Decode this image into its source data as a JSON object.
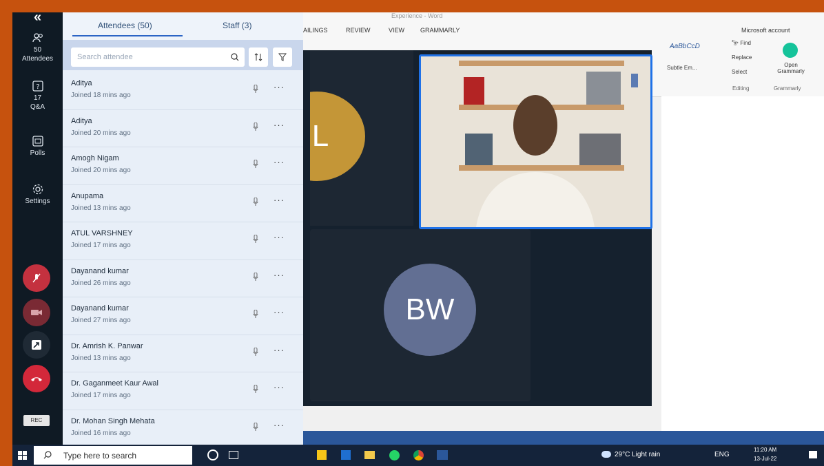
{
  "rail": {
    "attendees_count": "50",
    "attendees_label": "Attendees",
    "qa_count": "17",
    "qa_label": "Q&A",
    "polls_label": "Polls",
    "settings_label": "Settings",
    "rec_label": "REC"
  },
  "panel": {
    "tab_attendees": "Attendees (50)",
    "tab_staff": "Staff (3)",
    "search_placeholder": "Search attendee",
    "attendees": [
      {
        "name": "Aditya",
        "joined": "Joined 18 mins ago"
      },
      {
        "name": "Aditya",
        "joined": "Joined 20 mins ago"
      },
      {
        "name": "Amogh Nigam",
        "joined": "Joined 20 mins ago"
      },
      {
        "name": "Anupama",
        "joined": "Joined 13 mins ago"
      },
      {
        "name": "ATUL VARSHNEY",
        "joined": "Joined 17 mins ago"
      },
      {
        "name": "Dayanand kumar",
        "joined": "Joined 26 mins ago"
      },
      {
        "name": "Dayanand kumar",
        "joined": "Joined 27 mins ago"
      },
      {
        "name": "Dr. Amrish K. Panwar",
        "joined": "Joined 13 mins ago"
      },
      {
        "name": "Dr. Gaganmeet Kaur Awal",
        "joined": "Joined 17 mins ago"
      },
      {
        "name": "Dr. Mohan Singh Mehata",
        "joined": "Joined 16 mins ago"
      }
    ]
  },
  "word": {
    "title": "Experience - Word",
    "menu_mailings": "AILINGS",
    "menu_review": "REVIEW",
    "menu_view": "VIEW",
    "menu_grammarly": "GRAMMARLY",
    "account": "Microsoft account",
    "style_sample": "AaBbCcD",
    "style_name": "Subtle Em...",
    "find": "Find",
    "replace": "Replace",
    "select": "Select",
    "editing_group": "Editing",
    "open_grammarly": "Open Grammarly",
    "grammarly_group": "Grammarly"
  },
  "video": {
    "tile_l_initial": "L",
    "tile_bw_initials": "BW"
  },
  "taskbar": {
    "search_placeholder": "Type here to search",
    "weather": "29°C  Light rain",
    "lang": "ENG",
    "time": "11:20 AM",
    "date": "13-Jul-22"
  },
  "colors": {
    "outer_border": "#c6520e",
    "rail_bg": "#0f1a24",
    "panel_bg": "#e8eff8",
    "accent_blue": "#2b64c5",
    "mute_red": "#c4313f",
    "avatar_bw": "#626f93",
    "avatar_l": "#c49637"
  }
}
